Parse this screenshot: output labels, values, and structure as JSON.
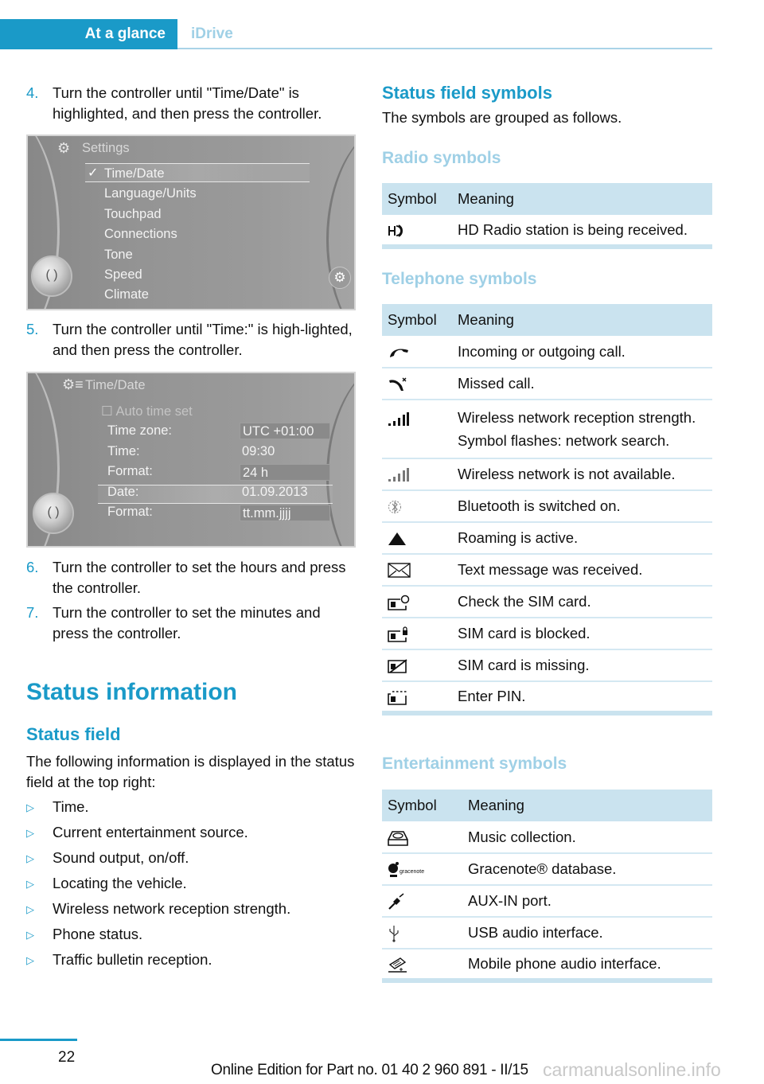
{
  "header": {
    "active_tab": "At a glance",
    "inactive_tab": "iDrive",
    "accent_color": "#1a9ac8"
  },
  "steps": [
    {
      "num": "4.",
      "text": "Turn the controller until \"Time/Date\" is highlighted, and then press the controller."
    },
    {
      "num": "5.",
      "text": "Turn the controller until \"Time:\" is high-lighted, and then press the controller."
    },
    {
      "num": "6.",
      "text": "Turn the controller to set the hours and press the controller."
    },
    {
      "num": "7.",
      "text": "Turn the controller to set the minutes and press the controller."
    }
  ],
  "settings_screen": {
    "title": "Settings",
    "title_icon": "gear-icon",
    "selected_check": "✓",
    "items": [
      "Time/Date",
      "Language/Units",
      "Touchpad",
      "Connections",
      "Tone",
      "Speed",
      "Climate"
    ]
  },
  "timedate_screen": {
    "title": "Time/Date",
    "auto_time": "☐ Auto time set",
    "rows": [
      {
        "label": "Time zone:",
        "value": "UTC +01:00"
      },
      {
        "label": "Time:",
        "value": "09:30"
      },
      {
        "label": "Format:",
        "value": "24 h"
      },
      {
        "label": "Date:",
        "value": "01.09.2013"
      },
      {
        "label": "Format:",
        "value": "tt.mm.jjjj"
      }
    ]
  },
  "status_information": {
    "heading": "Status information",
    "subheading": "Status field",
    "intro": "The following information is displayed in the status field at the top right:",
    "bullets": [
      "Time.",
      "Current entertainment source.",
      "Sound output, on/off.",
      "Locating the vehicle.",
      "Wireless network reception strength.",
      "Phone status.",
      "Traffic bulletin reception."
    ]
  },
  "status_symbols": {
    "heading": "Status field symbols",
    "intro": "The symbols are grouped as follows.",
    "col_symbol": "Symbol",
    "col_meaning": "Meaning",
    "radio": {
      "heading": "Radio symbols",
      "rows": [
        {
          "icon": "hd-radio-icon",
          "meaning": "HD Radio station is being received."
        }
      ]
    },
    "telephone": {
      "heading": "Telephone symbols",
      "rows": [
        {
          "icon": "phone-call-icon",
          "meaning": "Incoming or outgoing call."
        },
        {
          "icon": "missed-call-icon",
          "meaning": "Missed call."
        },
        {
          "icon": "signal-strength-icon",
          "meaning": "Wireless network reception strength.",
          "note": "Symbol flashes: network search."
        },
        {
          "icon": "no-network-icon",
          "meaning": "Wireless network is not available."
        },
        {
          "icon": "bluetooth-icon",
          "meaning": "Bluetooth is switched on."
        },
        {
          "icon": "roaming-icon",
          "meaning": "Roaming is active."
        },
        {
          "icon": "envelope-icon",
          "meaning": "Text message was received."
        },
        {
          "icon": "sim-check-icon",
          "meaning": "Check the SIM card."
        },
        {
          "icon": "sim-locked-icon",
          "meaning": "SIM card is blocked."
        },
        {
          "icon": "sim-missing-icon",
          "meaning": "SIM card is missing."
        },
        {
          "icon": "sim-pin-icon",
          "meaning": "Enter PIN."
        }
      ]
    },
    "entertainment": {
      "heading": "Entertainment symbols",
      "rows": [
        {
          "icon": "music-collection-icon",
          "meaning": "Music collection."
        },
        {
          "icon": "gracenote-icon",
          "meaning": "Gracenote® database.",
          "icon_text": "gracenote"
        },
        {
          "icon": "aux-in-icon",
          "meaning": "AUX-IN port."
        },
        {
          "icon": "usb-icon",
          "meaning": "USB audio interface."
        },
        {
          "icon": "mobile-audio-icon",
          "meaning": "Mobile phone audio interface."
        }
      ]
    }
  },
  "footer": {
    "page_number": "22",
    "edition": "Online Edition for Part no. 01 40 2 960 891 - II/15",
    "watermark": "carmanualsonline.info"
  }
}
